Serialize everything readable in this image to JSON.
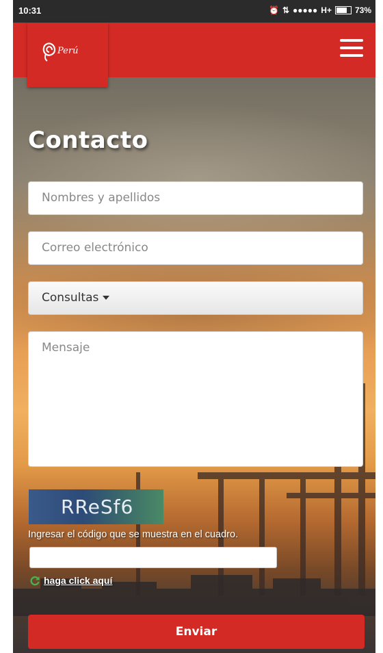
{
  "status_bar": {
    "time": "10:31",
    "network": "H+",
    "battery": "73%",
    "icons": [
      "alarm-icon",
      "data-arrows-icon",
      "signal-dots-icon",
      "battery-icon"
    ]
  },
  "header": {
    "logo_text": "Perú",
    "menu_icon": "hamburger-menu-icon",
    "brand_color": "#d42a26"
  },
  "page": {
    "title": "Contacto"
  },
  "form": {
    "name_placeholder": "Nombres y apellidos",
    "email_placeholder": "Correo electrónico",
    "subject_selected": "Consultas",
    "message_placeholder": "Mensaje",
    "captcha_code": "RReSf6",
    "captcha_label": "Ingresar el código que se muestra en el cuadro.",
    "captcha_input_value": "",
    "refresh_label": "haga click aquí",
    "submit_label": "Enviar"
  }
}
